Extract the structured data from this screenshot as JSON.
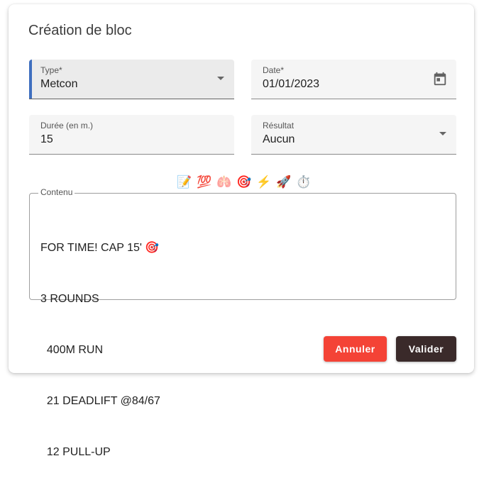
{
  "dialog": {
    "title": "Création de bloc",
    "type_field": {
      "label": "Type*",
      "value": "Metcon"
    },
    "date_field": {
      "label": "Date*",
      "value": "01/01/2023"
    },
    "duration_field": {
      "label": "Durée (en m.)",
      "value": "15"
    },
    "result_field": {
      "label": "Résultat",
      "value": "Aucun"
    },
    "emojis": [
      "📝",
      "💯",
      "🫁",
      "🎯",
      "⚡",
      "🚀",
      "⏱️"
    ],
    "content": {
      "label": "Contenu",
      "lines": [
        "FOR TIME! CAP 15' 🎯",
        "3 ROUNDS",
        "  400M RUN",
        "  21 DEADLIFT @84/67",
        "  12 PULL-UP"
      ]
    },
    "buttons": {
      "cancel": "Annuler",
      "ok": "Valider"
    },
    "colors": {
      "accent": "#3f6fbf",
      "cancel": "#f44336",
      "ok": "#3a2a2a"
    }
  }
}
